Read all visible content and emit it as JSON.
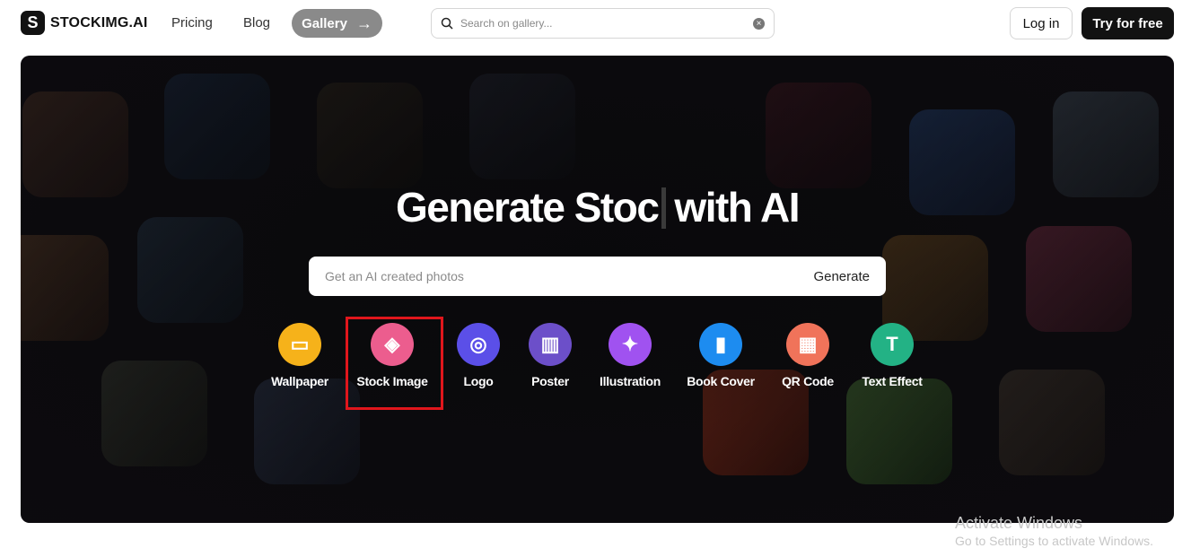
{
  "brand": {
    "logo_letter": "S",
    "name": "STOCKIMG.AI"
  },
  "nav": {
    "pricing": "Pricing",
    "blog": "Blog",
    "gallery": "Gallery",
    "gallery_arrow": "→"
  },
  "search": {
    "placeholder": "Search on gallery...",
    "value": "",
    "clear_glyph": "×"
  },
  "auth": {
    "login": "Log in",
    "try": "Try for free"
  },
  "hero": {
    "headline_left": "Generate Stoc",
    "headline_right": "with AI",
    "prompt_placeholder": "Get an AI created photos",
    "generate": "Generate"
  },
  "categories": [
    {
      "label": "Wallpaper",
      "icon": "image-icon",
      "glyph": "▭",
      "color": "#f6b21a"
    },
    {
      "label": "Stock Image",
      "icon": "cube-icon",
      "glyph": "◈",
      "color": "#ec5d8e"
    },
    {
      "label": "Logo",
      "icon": "focus-icon",
      "glyph": "◎",
      "color": "#5b4fe8"
    },
    {
      "label": "Poster",
      "icon": "map-icon",
      "glyph": "▥",
      "color": "#6c4fc9"
    },
    {
      "label": "Illustration",
      "icon": "sparkle-icon",
      "glyph": "✦",
      "color": "#a052f0"
    },
    {
      "label": "Book Cover",
      "icon": "book-icon",
      "glyph": "▮",
      "color": "#1d8cf0"
    },
    {
      "label": "QR Code",
      "icon": "qr-icon",
      "glyph": "▦",
      "color": "#f0735a"
    },
    {
      "label": "Text Effect",
      "icon": "text-icon",
      "glyph": "T",
      "color": "#23b285"
    }
  ],
  "highlighted_category": "Stock Image",
  "watermark": {
    "title": "Activate Windows",
    "subtitle": "Go to Settings to activate Windows."
  }
}
